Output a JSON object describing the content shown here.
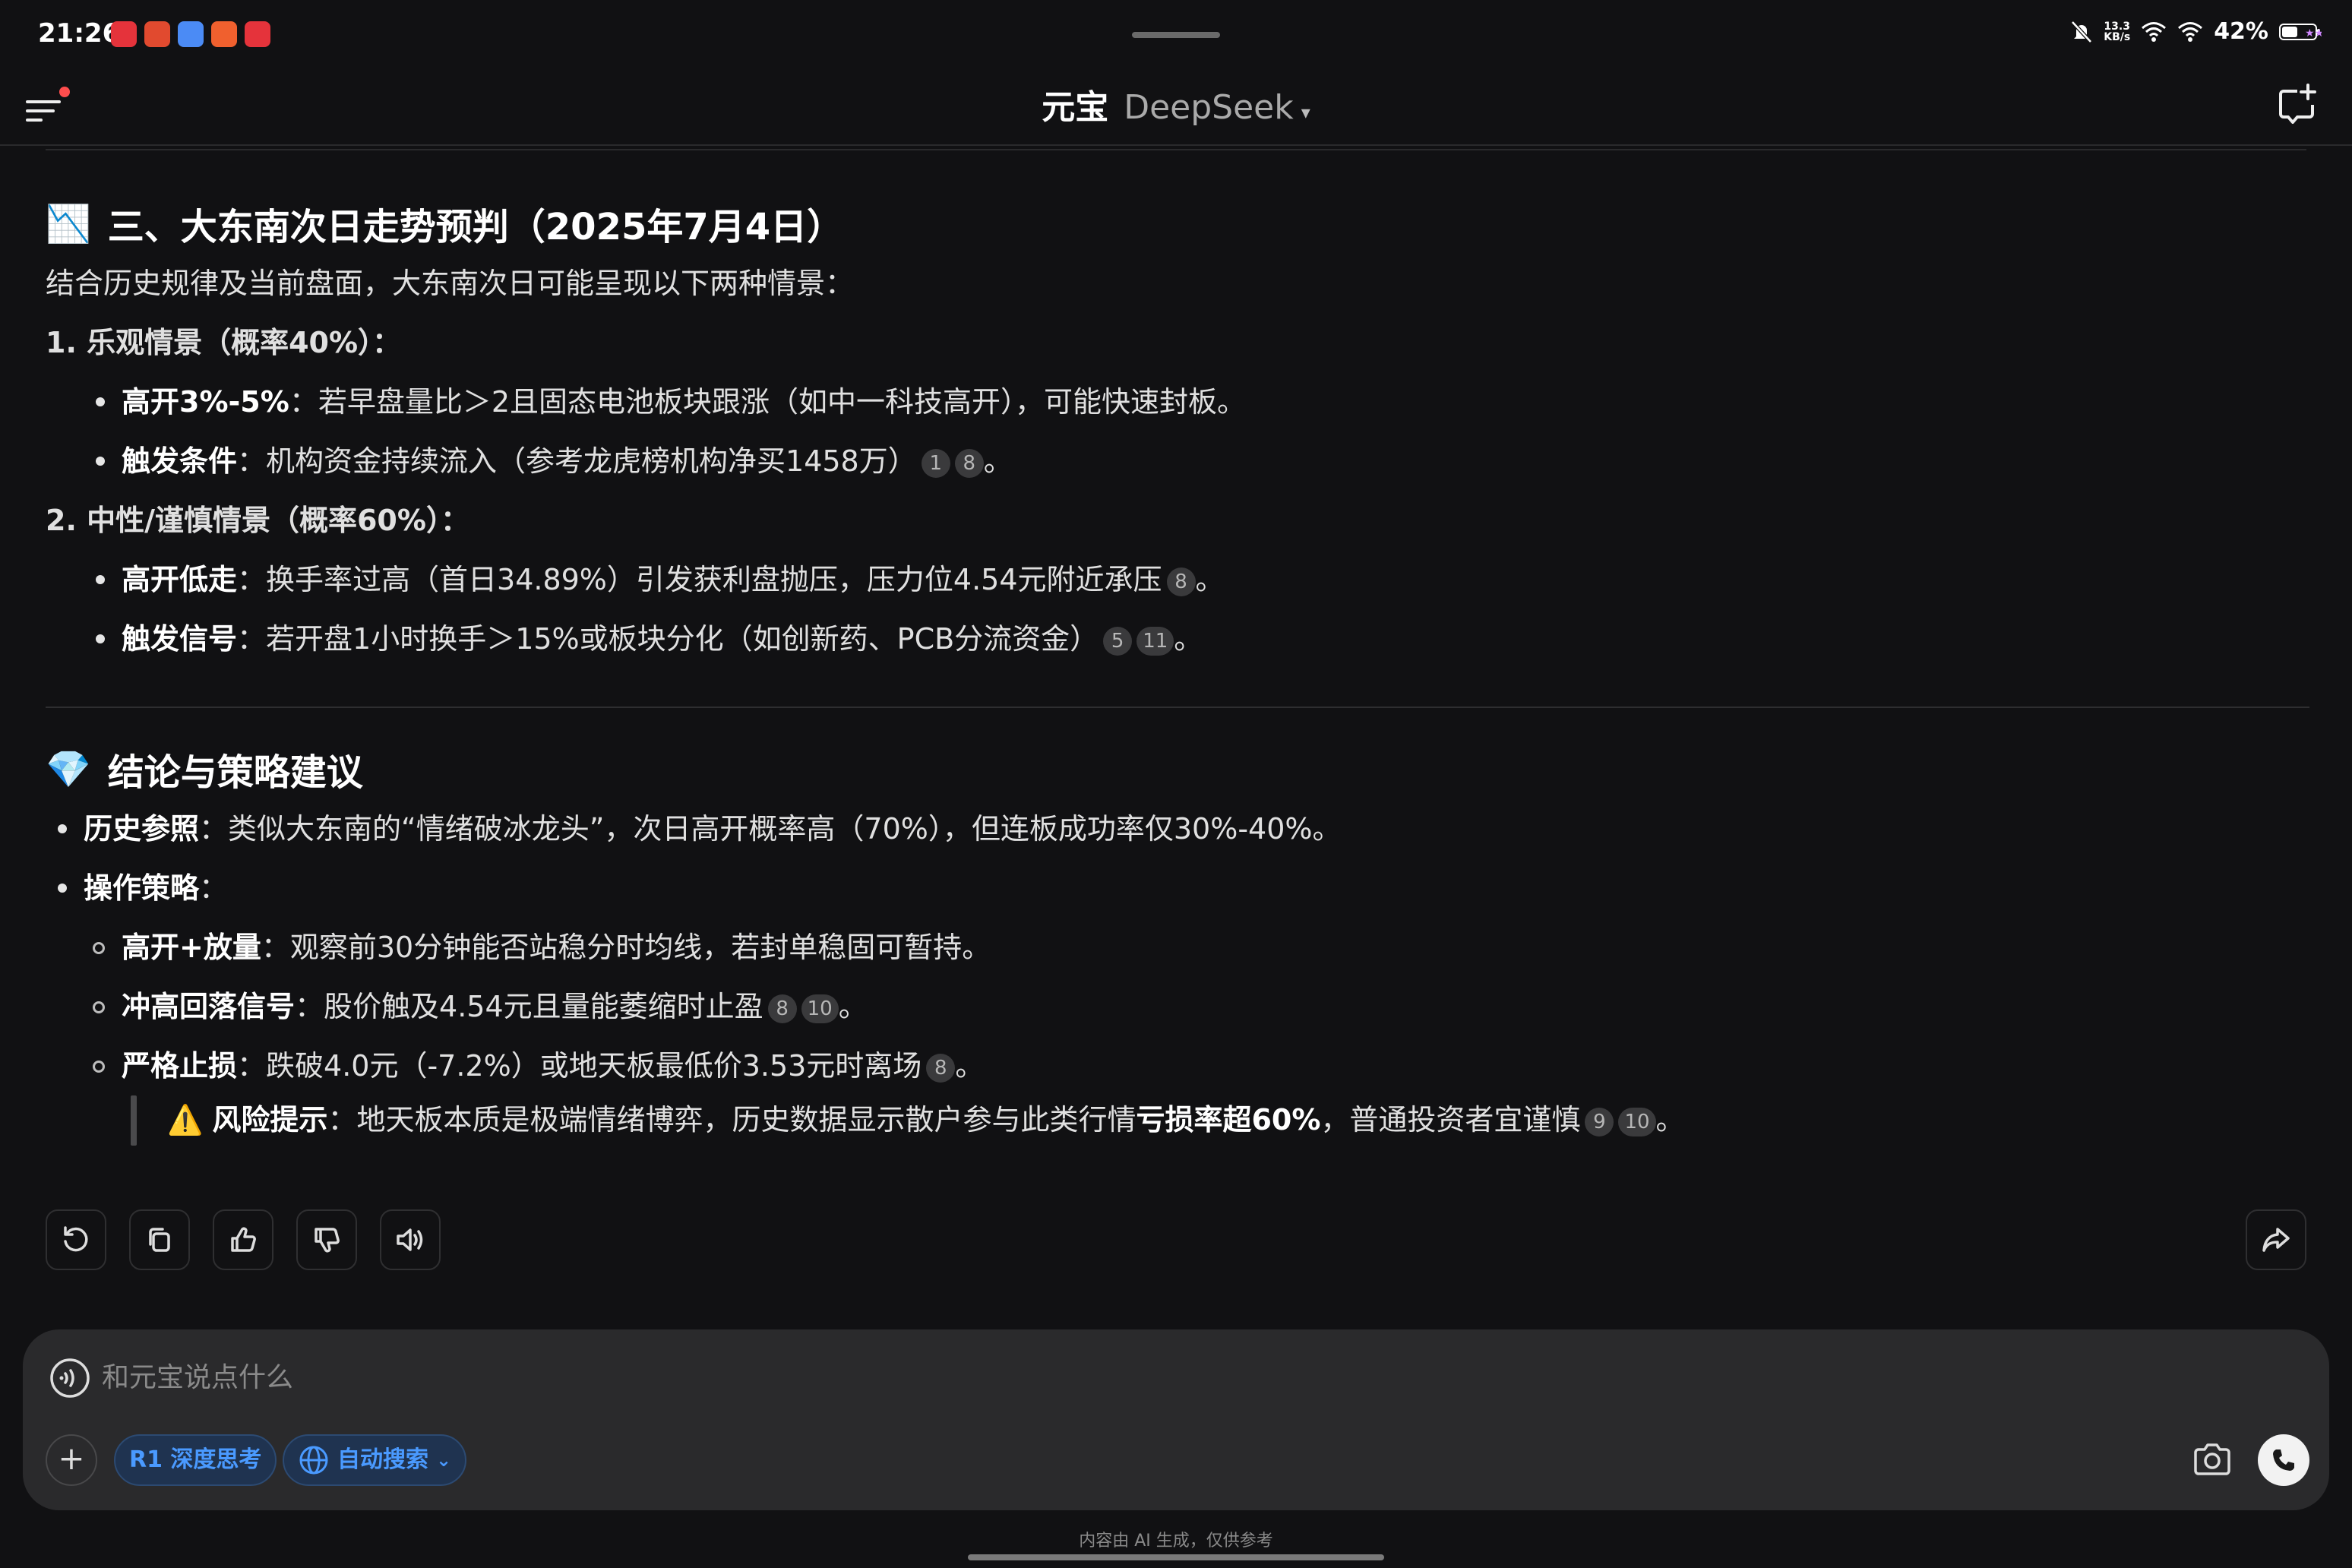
{
  "status": {
    "time": "21:26",
    "net_speed_top": "13.3",
    "net_speed_bottom": "KB/s",
    "battery": "42%",
    "notification_icons": [
      "netease-icon",
      "app-icon",
      "app-icon",
      "app-icon",
      "netease-icon"
    ]
  },
  "header": {
    "brand": "元宝",
    "model": "DeepSeek",
    "caret": "▾"
  },
  "section3": {
    "emoji": "📉",
    "title": "三、大东南次日走势预判（2025年7月4日）",
    "intro": "结合历史规律及当前盘面，大东南次日可能呈现以下两种情景：",
    "scenario1": {
      "heading": "1. 乐观情景（概率40%）：",
      "items": [
        {
          "label": "高开3%-5%",
          "text": "：若早盘量比＞2且固态电池板块跟涨（如中一科技高开），可能快速封板。",
          "refs": []
        },
        {
          "label": "触发条件",
          "text": "：机构资金持续流入（参考龙虎榜机构净买1458万）",
          "refs": [
            "1",
            "8"
          ]
        }
      ]
    },
    "scenario2": {
      "heading": "2. 中性/谨慎情景（概率60%）：",
      "items": [
        {
          "label": "高开低走",
          "text": "：换手率过高（首日34.89%）引发获利盘抛压，压力位4.54元附近承压",
          "refs": [
            "8"
          ]
        },
        {
          "label": "触发信号",
          "text": "：若开盘1小时换手＞15%或板块分化（如创新药、PCB分流资金）",
          "refs": [
            "5",
            "11"
          ]
        }
      ]
    }
  },
  "conclusion": {
    "emoji": "💎",
    "title": "结论与策略建议",
    "history_label": "历史参照",
    "history_text": "：类似大东南的“情绪破冰龙头”，次日高开概率高（70%），但连板成功率仅30%-40%。",
    "strategy_label": "操作策略",
    "strategy_colon": "：",
    "sub": [
      {
        "label": "高开+放量",
        "text": "：观察前30分钟能否站稳分时均线，若封单稳固可暂持。",
        "refs": []
      },
      {
        "label": "冲高回落信号",
        "text": "：股价触及4.54元且量能萎缩时止盈",
        "refs": [
          "8",
          "10"
        ]
      },
      {
        "label": "严格止损",
        "text": "：跌破4.0元（-7.2%）或地天板最低价3.53元时离场",
        "refs": [
          "8"
        ]
      }
    ],
    "risk": {
      "emoji": "⚠️",
      "label": "风险提示",
      "text1": "：地天板本质是极端情绪博弈，历史数据显示散户参与此类行情",
      "bold": "亏损率超60%",
      "text2": "，普通投资者宜谨慎",
      "refs": [
        "9",
        "10"
      ]
    },
    "period": "。"
  },
  "actions": [
    "regenerate-icon",
    "copy-icon",
    "thumbs-up-icon",
    "thumbs-down-icon",
    "speaker-icon"
  ],
  "composer": {
    "placeholder": "和元宝说点什么",
    "chip_deep": "R1 深度思考",
    "chip_search": "自动搜索",
    "chip_search_caret": "⌄"
  },
  "footer": {
    "disclaimer": "内容由 AI 生成，仅供参考"
  },
  "colors": {
    "background": "#111113",
    "accent": "#4a9aff",
    "composer": "#2a2a2c"
  }
}
